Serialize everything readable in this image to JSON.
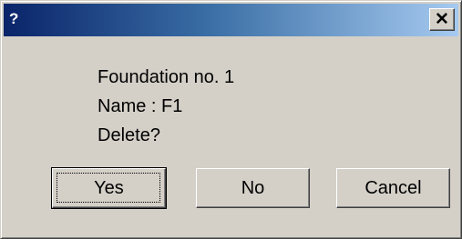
{
  "window": {
    "title": "?",
    "close_label": "✕",
    "close_icon": "close-icon",
    "titlebar_color_start": "#0a246a",
    "titlebar_color_end": "#a6caf0",
    "background": "#d4d0c8"
  },
  "message": {
    "lines": [
      "Foundation no. 1",
      "Name : F1",
      "Delete?"
    ]
  },
  "buttons": {
    "yes": "Yes",
    "no": "No",
    "cancel": "Cancel",
    "default": "yes"
  }
}
